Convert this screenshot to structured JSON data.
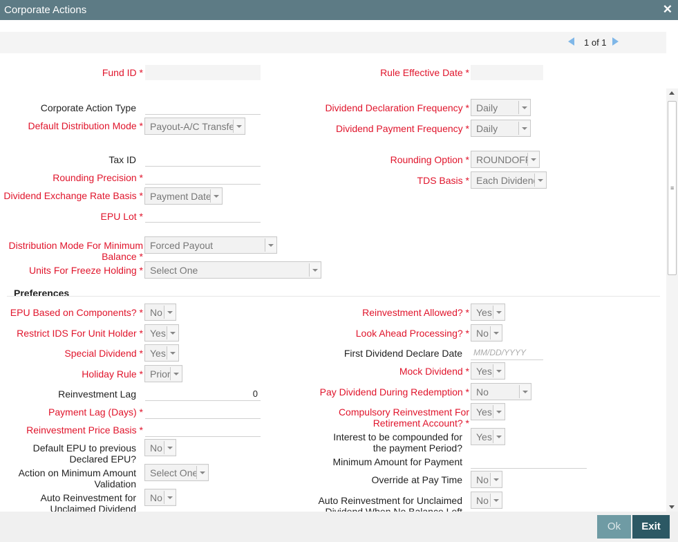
{
  "window": {
    "title": "Corporate Actions"
  },
  "pager": {
    "text": "1 of 1"
  },
  "header_fields": {
    "fund_id": {
      "label": "Fund ID",
      "value": ""
    },
    "rule_effective_date": {
      "label": "Rule Effective Date",
      "value": ""
    }
  },
  "fields": {
    "corporate_action_type": {
      "label": "Corporate Action Type",
      "value": ""
    },
    "default_distribution_mode": {
      "label": "Default Distribution Mode",
      "value": "Payout-A/C Transfer"
    },
    "dividend_declaration_frequency": {
      "label": "Dividend Declaration Frequency",
      "value": "Daily"
    },
    "dividend_payment_frequency": {
      "label": "Dividend Payment Frequency",
      "value": "Daily"
    },
    "tax_id": {
      "label": "Tax ID",
      "value": ""
    },
    "rounding_precision": {
      "label": "Rounding Precision",
      "value": ""
    },
    "rounding_option": {
      "label": "Rounding Option",
      "value": "ROUNDOFF"
    },
    "tds_basis": {
      "label": "TDS Basis",
      "value": "Each Dividend"
    },
    "dividend_exchange_rate_basis": {
      "label": "Dividend Exchange Rate Basis",
      "value": "Payment Date"
    },
    "epu_lot": {
      "label": "EPU Lot",
      "value": ""
    },
    "distribution_mode_min_balance": {
      "label": "Distribution Mode For Minimum Balance",
      "value": "Forced Payout"
    },
    "units_for_freeze_holding": {
      "label": "Units For Freeze Holding",
      "value": "Select One"
    }
  },
  "preferences": {
    "heading": "Preferences",
    "epu_based_on_components": {
      "label": "EPU Based on Components?",
      "value": "No"
    },
    "restrict_ids_for_unit_holder": {
      "label": "Restrict IDS For Unit Holder",
      "value": "Yes"
    },
    "special_dividend": {
      "label": "Special Dividend",
      "value": "Yes"
    },
    "holiday_rule": {
      "label": "Holiday Rule",
      "value": "Prior"
    },
    "reinvestment_lag": {
      "label": "Reinvestment Lag",
      "value": "0"
    },
    "payment_lag_days": {
      "label": "Payment Lag (Days)",
      "value": ""
    },
    "reinvestment_price_basis": {
      "label": "Reinvestment Price Basis",
      "value": ""
    },
    "default_epu_previous": {
      "label": "Default EPU to previous Declared EPU?",
      "value": "No"
    },
    "action_on_min_amount_validation": {
      "label": "Action on Minimum Amount Validation",
      "value": "Select One"
    },
    "auto_reinvestment_unclaimed": {
      "label": "Auto Reinvestment for Unclaimed Dividend",
      "value": "No"
    },
    "reinvestment_allowed": {
      "label": "Reinvestment Allowed?",
      "value": "Yes"
    },
    "look_ahead_processing": {
      "label": "Look Ahead Processing?",
      "value": "No"
    },
    "first_dividend_declare_date": {
      "label": "First Dividend Declare Date",
      "placeholder": "MM/DD/YYYY"
    },
    "mock_dividend": {
      "label": "Mock Dividend",
      "value": "Yes"
    },
    "pay_dividend_during_redemption": {
      "label": "Pay Dividend During Redemption",
      "value": "No"
    },
    "compulsory_reinvestment_retirement": {
      "label": "Compulsory Reinvestment For Retirement Account?",
      "value": "Yes"
    },
    "interest_compounded_payment_period": {
      "label": "Interest to be compounded for the payment Period?",
      "value": "Yes"
    },
    "minimum_amount_for_payment": {
      "label": "Minimum Amount for Payment",
      "value": ""
    },
    "override_at_pay_time": {
      "label": "Override at Pay Time",
      "value": "No"
    },
    "auto_reinvestment_no_balance": {
      "label": "Auto Reinvestment for Unclaimed Dividend When No Balance Left",
      "value": "No"
    }
  },
  "footer": {
    "ok_label": "Ok",
    "exit_label": "Exit"
  },
  "colors": {
    "titlebar": "#5d7b85",
    "required_label": "#e0142b",
    "exit_button": "#2c5864",
    "ok_button": "#6f9ba4"
  }
}
